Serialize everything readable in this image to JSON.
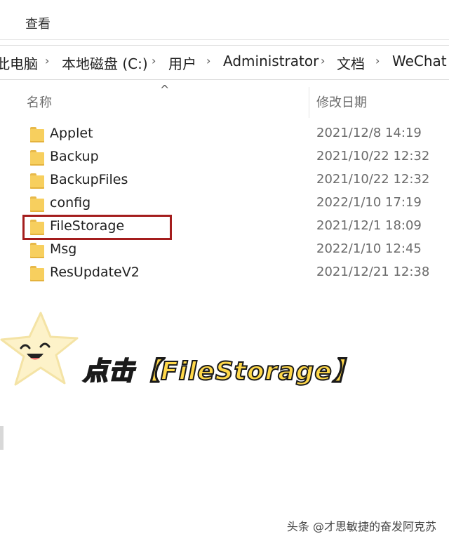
{
  "ribbon": {
    "view_tab": "查看"
  },
  "address_bar": {
    "crumbs": [
      "此电脑",
      "本地磁盘 (C:)",
      "用户",
      "Administrator",
      "文档",
      "WeChat Files"
    ],
    "separator": "›"
  },
  "file_list": {
    "sort_indicator": "^",
    "columns": {
      "name": "名称",
      "modified": "修改日期"
    },
    "rows": [
      {
        "name": "Applet",
        "modified": "2021/12/8 14:19"
      },
      {
        "name": "Backup",
        "modified": "2021/10/22 12:32"
      },
      {
        "name": "BackupFiles",
        "modified": "2021/10/22 12:32"
      },
      {
        "name": "config",
        "modified": "2022/1/10 17:19"
      },
      {
        "name": "FileStorage",
        "modified": "2021/12/1 18:09"
      },
      {
        "name": "Msg",
        "modified": "2022/1/10 12:45"
      },
      {
        "name": "ResUpdateV2",
        "modified": "2021/12/21 12:38"
      }
    ],
    "highlighted_row": "FileStorage",
    "highlight_color": "#a41d1d"
  },
  "overlay": {
    "caption": "点击【FileStorage】",
    "caption_color": "#ffd84a",
    "mascot_icon": "smiling-star-icon",
    "watermark": "头条 @才思敏捷的奋发阿克苏"
  }
}
